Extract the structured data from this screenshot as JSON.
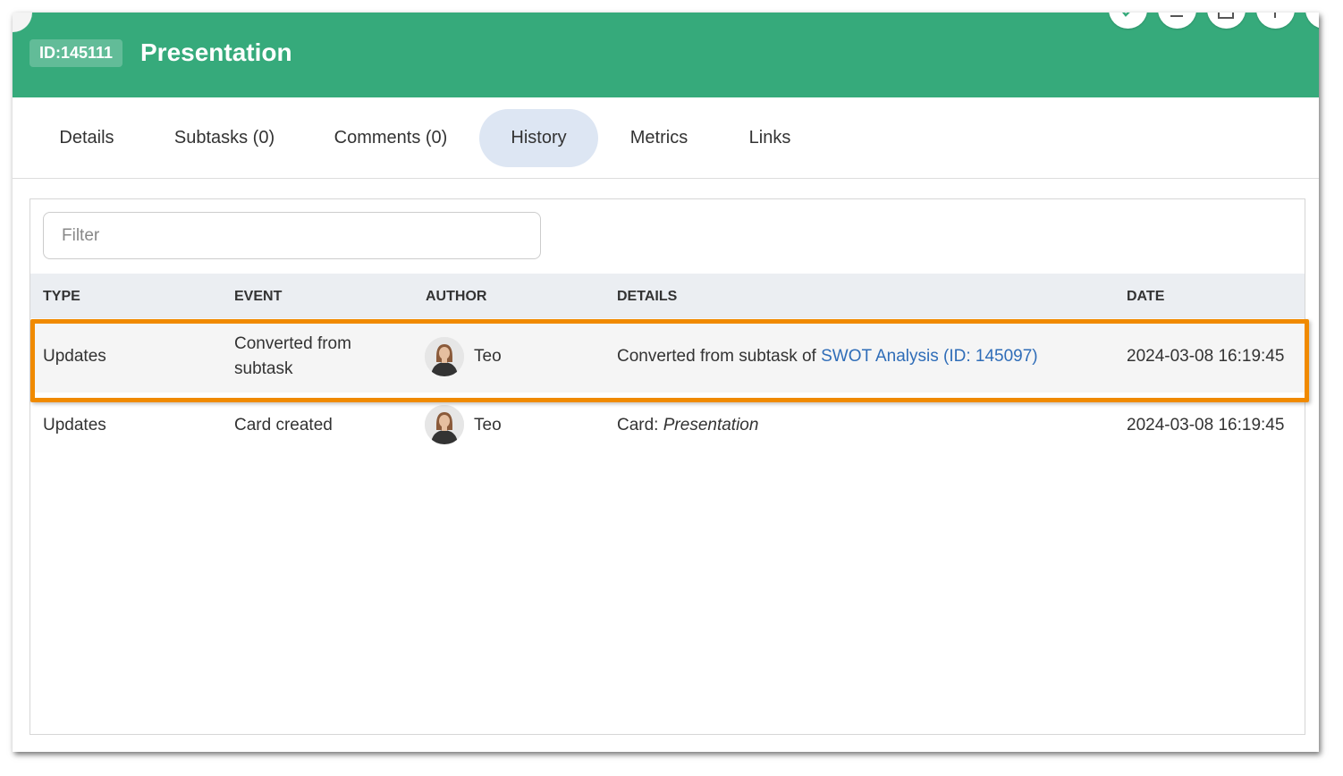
{
  "card": {
    "id_label": "ID:145111",
    "title": "Presentation"
  },
  "header_buttons": [
    {
      "icon": "link-icon"
    },
    {
      "icon": "user-icon"
    },
    {
      "icon": "card-icon"
    },
    {
      "icon": "plus-icon"
    }
  ],
  "tabs": [
    {
      "label": "Details",
      "active": false
    },
    {
      "label": "Subtasks (0)",
      "active": false
    },
    {
      "label": "Comments (0)",
      "active": false
    },
    {
      "label": "History",
      "active": true
    },
    {
      "label": "Metrics",
      "active": false
    },
    {
      "label": "Links",
      "active": false
    }
  ],
  "filter": {
    "placeholder": "Filter",
    "value": ""
  },
  "table": {
    "columns": [
      "TYPE",
      "EVENT",
      "AUTHOR",
      "DETAILS",
      "DATE"
    ],
    "rows": [
      {
        "type": "Updates",
        "event_line1": "Converted from",
        "event_line2": "subtask",
        "author": "Teo",
        "details_prefix": "Converted from subtask of ",
        "details_link": "SWOT Analysis (ID: 145097)",
        "date": "2024-03-08 16:19:45",
        "highlighted": true
      },
      {
        "type": "Updates",
        "event": "Card created",
        "author": "Teo",
        "details_prefix": "Card: ",
        "details_italic": "Presentation",
        "date": "2024-03-08 16:19:45",
        "highlighted": false
      }
    ]
  },
  "colors": {
    "header": "#36aa7b",
    "active_tab": "#dde6f3",
    "table_header": "#ebeef2",
    "link": "#2f6db8",
    "highlight_border": "#f08a00"
  }
}
